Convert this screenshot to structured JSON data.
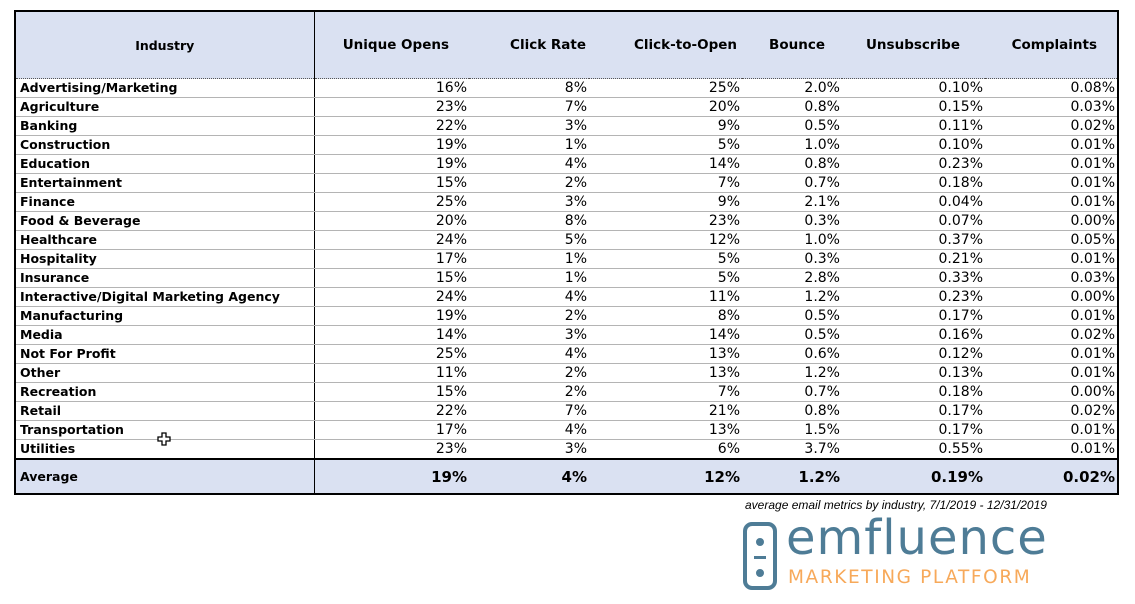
{
  "table": {
    "headers": [
      "Industry",
      "Unique Opens",
      "Click Rate",
      "Click-to-Open",
      "Bounce",
      "Unsubscribe",
      "Complaints"
    ],
    "rows": [
      {
        "industry": "Advertising/Marketing",
        "unique_opens": "16%",
        "click_rate": "8%",
        "click_to_open": "25%",
        "bounce": "2.0%",
        "unsubscribe": "0.10%",
        "complaints": "0.08%"
      },
      {
        "industry": "Agriculture",
        "unique_opens": "23%",
        "click_rate": "7%",
        "click_to_open": "20%",
        "bounce": "0.8%",
        "unsubscribe": "0.15%",
        "complaints": "0.03%"
      },
      {
        "industry": "Banking",
        "unique_opens": "22%",
        "click_rate": "3%",
        "click_to_open": "9%",
        "bounce": "0.5%",
        "unsubscribe": "0.11%",
        "complaints": "0.02%"
      },
      {
        "industry": "Construction",
        "unique_opens": "19%",
        "click_rate": "1%",
        "click_to_open": "5%",
        "bounce": "1.0%",
        "unsubscribe": "0.10%",
        "complaints": "0.01%"
      },
      {
        "industry": "Education",
        "unique_opens": "19%",
        "click_rate": "4%",
        "click_to_open": "14%",
        "bounce": "0.8%",
        "unsubscribe": "0.23%",
        "complaints": "0.01%"
      },
      {
        "industry": "Entertainment",
        "unique_opens": "15%",
        "click_rate": "2%",
        "click_to_open": "7%",
        "bounce": "0.7%",
        "unsubscribe": "0.18%",
        "complaints": "0.01%"
      },
      {
        "industry": "Finance",
        "unique_opens": "25%",
        "click_rate": "3%",
        "click_to_open": "9%",
        "bounce": "2.1%",
        "unsubscribe": "0.04%",
        "complaints": "0.01%"
      },
      {
        "industry": "Food & Beverage",
        "unique_opens": "20%",
        "click_rate": "8%",
        "click_to_open": "23%",
        "bounce": "0.3%",
        "unsubscribe": "0.07%",
        "complaints": "0.00%"
      },
      {
        "industry": "Healthcare",
        "unique_opens": "24%",
        "click_rate": "5%",
        "click_to_open": "12%",
        "bounce": "1.0%",
        "unsubscribe": "0.37%",
        "complaints": "0.05%"
      },
      {
        "industry": "Hospitality",
        "unique_opens": "17%",
        "click_rate": "1%",
        "click_to_open": "5%",
        "bounce": "0.3%",
        "unsubscribe": "0.21%",
        "complaints": "0.01%"
      },
      {
        "industry": "Insurance",
        "unique_opens": "15%",
        "click_rate": "1%",
        "click_to_open": "5%",
        "bounce": "2.8%",
        "unsubscribe": "0.33%",
        "complaints": "0.03%"
      },
      {
        "industry": "Interactive/Digital Marketing Agency",
        "unique_opens": "24%",
        "click_rate": "4%",
        "click_to_open": "11%",
        "bounce": "1.2%",
        "unsubscribe": "0.23%",
        "complaints": "0.00%"
      },
      {
        "industry": "Manufacturing",
        "unique_opens": "19%",
        "click_rate": "2%",
        "click_to_open": "8%",
        "bounce": "0.5%",
        "unsubscribe": "0.17%",
        "complaints": "0.01%"
      },
      {
        "industry": "Media",
        "unique_opens": "14%",
        "click_rate": "3%",
        "click_to_open": "14%",
        "bounce": "0.5%",
        "unsubscribe": "0.16%",
        "complaints": "0.02%"
      },
      {
        "industry": "Not For Profit",
        "unique_opens": "25%",
        "click_rate": "4%",
        "click_to_open": "13%",
        "bounce": "0.6%",
        "unsubscribe": "0.12%",
        "complaints": "0.01%"
      },
      {
        "industry": "Other",
        "unique_opens": "11%",
        "click_rate": "2%",
        "click_to_open": "13%",
        "bounce": "1.2%",
        "unsubscribe": "0.13%",
        "complaints": "0.01%"
      },
      {
        "industry": "Recreation",
        "unique_opens": "15%",
        "click_rate": "2%",
        "click_to_open": "7%",
        "bounce": "0.7%",
        "unsubscribe": "0.18%",
        "complaints": "0.00%"
      },
      {
        "industry": "Retail",
        "unique_opens": "22%",
        "click_rate": "7%",
        "click_to_open": "21%",
        "bounce": "0.8%",
        "unsubscribe": "0.17%",
        "complaints": "0.02%"
      },
      {
        "industry": "Transportation",
        "unique_opens": "17%",
        "click_rate": "4%",
        "click_to_open": "13%",
        "bounce": "1.5%",
        "unsubscribe": "0.17%",
        "complaints": "0.01%"
      },
      {
        "industry": "Utilities",
        "unique_opens": "23%",
        "click_rate": "3%",
        "click_to_open": "6%",
        "bounce": "3.7%",
        "unsubscribe": "0.55%",
        "complaints": "0.01%"
      }
    ],
    "average": {
      "industry": "Average",
      "unique_opens": "19%",
      "click_rate": "4%",
      "click_to_open": "12%",
      "bounce": "1.2%",
      "unsubscribe": "0.19%",
      "complaints": "0.02%"
    }
  },
  "caption": "average email metrics by industry, 7/1/2019 - 12/31/2019",
  "logo": {
    "brand": "emfluence",
    "tagline": "MARKETING PLATFORM",
    "brand_color": "#4e7c96",
    "tagline_color": "#f7a95a"
  },
  "colors": {
    "header_bg": "#dae1f2",
    "row_divider": "#b4b4b4"
  }
}
